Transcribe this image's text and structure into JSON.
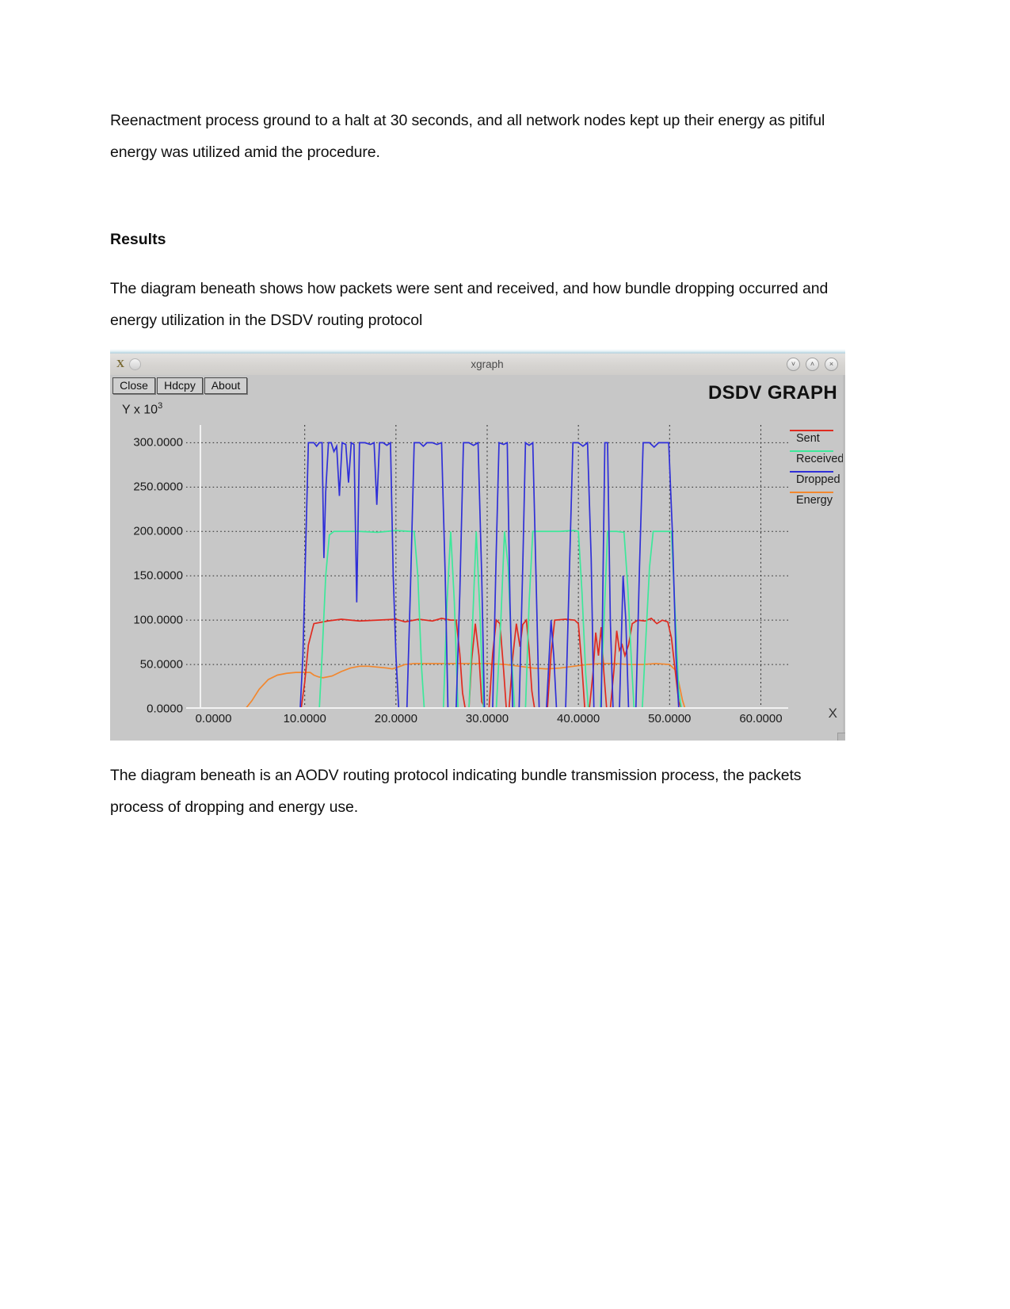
{
  "document": {
    "paragraph_1": "Reenactment process ground to a halt at 30 seconds, and all network nodes kept up their energy as pitiful energy was utilized amid the procedure.",
    "heading_results": "Results",
    "paragraph_2": "The diagram beneath shows how packets were sent and received, and how bundle dropping occurred and energy utilization in the DSDV routing protocol",
    "paragraph_3": "The diagram beneath is an AODV routing protocol indicating bundle transmission process, the packets process of dropping and energy use."
  },
  "xgraph_window": {
    "title": "xgraph",
    "app_icon": "X",
    "window_controls": {
      "minimize": "˅",
      "maximize": "˄",
      "close": "×"
    },
    "toolbar": {
      "close_label": "Close",
      "hdcpy_label": "Hdcpy",
      "about_label": "About"
    },
    "graph_title": "DSDV GRAPH",
    "y_axis_exponent_label": "Y x 10",
    "y_axis_exponent_value": "3",
    "corner_marker": "X"
  },
  "chart_data": {
    "type": "line",
    "title": "DSDV GRAPH",
    "xlabel": "",
    "ylabel": "Y x 10^3",
    "xlim": [
      -3,
      63
    ],
    "ylim": [
      0,
      320
    ],
    "grid": true,
    "legend_position": "right",
    "x_ticks": [
      "0.0000",
      "10.0000",
      "20.0000",
      "30.0000",
      "40.0000",
      "50.0000",
      "60.0000"
    ],
    "x_tick_values": [
      0,
      10,
      20,
      30,
      40,
      50,
      60
    ],
    "y_ticks": [
      "0.0000",
      "50.0000",
      "100.0000",
      "150.0000",
      "200.0000",
      "250.0000",
      "300.0000"
    ],
    "y_tick_values": [
      0,
      50,
      100,
      150,
      200,
      250,
      300
    ],
    "colors": {
      "sent": "#e02b20",
      "received": "#3ce89a",
      "dropped": "#2f2fd8",
      "energy": "#f2872e"
    },
    "series": [
      {
        "name": "Sent",
        "color": "#e02b20",
        "points": [
          [
            0,
            0
          ],
          [
            9.6,
            0
          ],
          [
            10.0,
            30
          ],
          [
            10.4,
            72
          ],
          [
            11.0,
            96
          ],
          [
            12.5,
            99
          ],
          [
            14,
            101
          ],
          [
            16,
            99
          ],
          [
            18,
            100
          ],
          [
            20,
            101
          ],
          [
            21,
            98
          ],
          [
            22.5,
            101
          ],
          [
            24,
            99
          ],
          [
            25,
            102
          ],
          [
            26,
            100
          ],
          [
            26.6,
            100
          ],
          [
            27.0,
            62
          ],
          [
            27.3,
            18
          ],
          [
            27.6,
            0
          ],
          [
            28.0,
            0
          ],
          [
            28.3,
            55
          ],
          [
            28.7,
            96
          ],
          [
            29.1,
            60
          ],
          [
            29.4,
            8
          ],
          [
            29.8,
            0
          ],
          [
            30.2,
            0
          ],
          [
            30.6,
            62
          ],
          [
            31.0,
            100
          ],
          [
            31.4,
            96
          ],
          [
            31.8,
            44
          ],
          [
            32.1,
            0
          ],
          [
            32.4,
            0
          ],
          [
            32.8,
            58
          ],
          [
            33.2,
            96
          ],
          [
            33.6,
            70
          ],
          [
            33.9,
            95
          ],
          [
            34.3,
            100
          ],
          [
            34.6,
            66
          ],
          [
            34.9,
            20
          ],
          [
            35.2,
            0
          ],
          [
            36.0,
            0
          ],
          [
            36.6,
            0
          ],
          [
            37.0,
            62
          ],
          [
            37.4,
            100
          ],
          [
            38.6,
            101
          ],
          [
            39.6,
            100
          ],
          [
            40.0,
            96
          ],
          [
            40.4,
            46
          ],
          [
            40.7,
            0
          ],
          [
            41.2,
            0
          ],
          [
            41.6,
            40
          ],
          [
            41.9,
            86
          ],
          [
            42.2,
            60
          ],
          [
            42.5,
            92
          ],
          [
            42.8,
            40
          ],
          [
            43.1,
            0
          ],
          [
            43.5,
            0
          ],
          [
            43.9,
            44
          ],
          [
            44.2,
            88
          ],
          [
            44.5,
            66
          ],
          [
            44.8,
            72
          ],
          [
            45.1,
            60
          ],
          [
            45.5,
            72
          ],
          [
            45.9,
            96
          ],
          [
            46.5,
            100
          ],
          [
            47.3,
            99
          ],
          [
            48.0,
            102
          ],
          [
            48.6,
            96
          ],
          [
            49.2,
            100
          ],
          [
            49.8,
            98
          ],
          [
            50.2,
            80
          ],
          [
            50.6,
            44
          ],
          [
            51.0,
            8
          ],
          [
            51.3,
            0
          ],
          [
            60,
            0
          ]
        ]
      },
      {
        "name": "Received",
        "color": "#3ce89a",
        "points": [
          [
            0,
            0
          ],
          [
            11.6,
            0
          ],
          [
            11.9,
            60
          ],
          [
            12.3,
            150
          ],
          [
            12.7,
            196
          ],
          [
            13.2,
            200
          ],
          [
            16,
            200
          ],
          [
            18,
            199
          ],
          [
            20,
            201
          ],
          [
            21.5,
            200
          ],
          [
            22.0,
            200
          ],
          [
            22.4,
            150
          ],
          [
            22.8,
            48
          ],
          [
            23.1,
            0
          ],
          [
            23.5,
            0
          ],
          [
            24.0,
            0
          ],
          [
            25.2,
            0
          ],
          [
            25.6,
            120
          ],
          [
            26.0,
            200
          ],
          [
            26.4,
            120
          ],
          [
            26.8,
            0
          ],
          [
            27.2,
            0
          ],
          [
            28.0,
            0
          ],
          [
            28.4,
            96
          ],
          [
            28.8,
            200
          ],
          [
            29.2,
            110
          ],
          [
            29.6,
            0
          ],
          [
            30.0,
            0
          ],
          [
            31.0,
            0
          ],
          [
            31.5,
            100
          ],
          [
            31.9,
            200
          ],
          [
            32.3,
            160
          ],
          [
            32.7,
            56
          ],
          [
            33.0,
            0
          ],
          [
            33.4,
            0
          ],
          [
            34.2,
            0
          ],
          [
            34.6,
            120
          ],
          [
            35.0,
            200
          ],
          [
            36.0,
            200
          ],
          [
            38.0,
            200
          ],
          [
            39.5,
            201
          ],
          [
            40.0,
            200
          ],
          [
            40.4,
            130
          ],
          [
            40.8,
            40
          ],
          [
            41.1,
            0
          ],
          [
            41.5,
            0
          ],
          [
            42.4,
            0
          ],
          [
            42.8,
            96
          ],
          [
            43.2,
            200
          ],
          [
            44.2,
            200
          ],
          [
            45.0,
            199
          ],
          [
            45.4,
            140
          ],
          [
            45.8,
            56
          ],
          [
            46.1,
            0
          ],
          [
            46.5,
            0
          ],
          [
            47.0,
            0
          ],
          [
            47.4,
            80
          ],
          [
            47.8,
            160
          ],
          [
            48.2,
            200
          ],
          [
            49.4,
            200
          ],
          [
            50.2,
            200
          ],
          [
            50.6,
            110
          ],
          [
            51.0,
            20
          ],
          [
            51.3,
            0
          ],
          [
            60,
            0
          ]
        ]
      },
      {
        "name": "Dropped",
        "color": "#2f2fd8",
        "points": [
          [
            0,
            0
          ],
          [
            9.5,
            0
          ],
          [
            9.8,
            60
          ],
          [
            10.1,
            180
          ],
          [
            10.4,
            300
          ],
          [
            11.0,
            300
          ],
          [
            11.3,
            296
          ],
          [
            11.6,
            300
          ],
          [
            11.9,
            300
          ],
          [
            12.1,
            170
          ],
          [
            12.3,
            245
          ],
          [
            12.6,
            300
          ],
          [
            12.9,
            300
          ],
          [
            13.2,
            290
          ],
          [
            13.5,
            296
          ],
          [
            13.8,
            240
          ],
          [
            14.1,
            300
          ],
          [
            14.5,
            298
          ],
          [
            14.8,
            255
          ],
          [
            15.1,
            300
          ],
          [
            15.4,
            298
          ],
          [
            15.7,
            120
          ],
          [
            16.0,
            300
          ],
          [
            16.6,
            300
          ],
          [
            17.2,
            298
          ],
          [
            17.6,
            300
          ],
          [
            17.9,
            230
          ],
          [
            18.2,
            300
          ],
          [
            18.6,
            300
          ],
          [
            19.0,
            297
          ],
          [
            19.4,
            300
          ],
          [
            19.7,
            150
          ],
          [
            20.0,
            60
          ],
          [
            20.3,
            0
          ],
          [
            20.7,
            0
          ],
          [
            21.2,
            0
          ],
          [
            21.6,
            140
          ],
          [
            22.0,
            300
          ],
          [
            22.6,
            300
          ],
          [
            23.0,
            296
          ],
          [
            23.4,
            300
          ],
          [
            24.0,
            300
          ],
          [
            24.5,
            298
          ],
          [
            25.0,
            300
          ],
          [
            25.4,
            150
          ],
          [
            25.7,
            0
          ],
          [
            26.1,
            0
          ],
          [
            26.6,
            0
          ],
          [
            27.0,
            130
          ],
          [
            27.4,
            300
          ],
          [
            28.0,
            300
          ],
          [
            28.5,
            297
          ],
          [
            29.0,
            300
          ],
          [
            29.4,
            150
          ],
          [
            29.7,
            0
          ],
          [
            30.1,
            0
          ],
          [
            30.6,
            0
          ],
          [
            31.0,
            180
          ],
          [
            31.3,
            300
          ],
          [
            31.8,
            298
          ],
          [
            32.2,
            300
          ],
          [
            32.5,
            120
          ],
          [
            32.8,
            0
          ],
          [
            33.1,
            0
          ],
          [
            33.5,
            0
          ],
          [
            33.9,
            160
          ],
          [
            34.2,
            300
          ],
          [
            34.6,
            297
          ],
          [
            35.0,
            300
          ],
          [
            35.4,
            130
          ],
          [
            35.7,
            0
          ],
          [
            36.0,
            0
          ],
          [
            36.5,
            0
          ],
          [
            37.0,
            100
          ],
          [
            37.3,
            60
          ],
          [
            37.6,
            0
          ],
          [
            38.0,
            0
          ],
          [
            38.6,
            0
          ],
          [
            39.0,
            150
          ],
          [
            39.4,
            300
          ],
          [
            40.0,
            300
          ],
          [
            40.5,
            296
          ],
          [
            41.0,
            300
          ],
          [
            41.4,
            170
          ],
          [
            41.7,
            0
          ],
          [
            42.1,
            0
          ],
          [
            42.5,
            0
          ],
          [
            42.9,
            300
          ],
          [
            43.2,
            300
          ],
          [
            43.5,
            100
          ],
          [
            43.8,
            0
          ],
          [
            44.1,
            0
          ],
          [
            44.5,
            0
          ],
          [
            44.9,
            150
          ],
          [
            45.2,
            100
          ],
          [
            45.5,
            0
          ],
          [
            45.9,
            0
          ],
          [
            46.3,
            0
          ],
          [
            46.7,
            160
          ],
          [
            47.1,
            300
          ],
          [
            47.8,
            300
          ],
          [
            48.3,
            295
          ],
          [
            48.8,
            300
          ],
          [
            49.4,
            300
          ],
          [
            49.9,
            300
          ],
          [
            50.3,
            200
          ],
          [
            50.7,
            60
          ],
          [
            51.0,
            0
          ],
          [
            60,
            0
          ]
        ]
      },
      {
        "name": "Energy",
        "color": "#f2872e",
        "points": [
          [
            0,
            0
          ],
          [
            3.5,
            0
          ],
          [
            4.2,
            9
          ],
          [
            5.0,
            22
          ],
          [
            6.0,
            33
          ],
          [
            7.0,
            38
          ],
          [
            8.0,
            40
          ],
          [
            9.0,
            41
          ],
          [
            10.0,
            41
          ],
          [
            10.6,
            41
          ],
          [
            11.0,
            38
          ],
          [
            11.5,
            36
          ],
          [
            12.0,
            35
          ],
          [
            13.0,
            37
          ],
          [
            14.0,
            42
          ],
          [
            15.0,
            46
          ],
          [
            16.0,
            48
          ],
          [
            17.0,
            48
          ],
          [
            18.0,
            47
          ],
          [
            19.0,
            46
          ],
          [
            19.6,
            45
          ],
          [
            20.2,
            47
          ],
          [
            21.0,
            50
          ],
          [
            22.0,
            51
          ],
          [
            23.0,
            51
          ],
          [
            24.5,
            51
          ],
          [
            26.0,
            51
          ],
          [
            28.0,
            51
          ],
          [
            30.0,
            51
          ],
          [
            32.0,
            50
          ],
          [
            33.5,
            48
          ],
          [
            35.0,
            46
          ],
          [
            36.5,
            45
          ],
          [
            38.0,
            46
          ],
          [
            39.5,
            48
          ],
          [
            41.0,
            50
          ],
          [
            42.5,
            51
          ],
          [
            44.0,
            51
          ],
          [
            45.5,
            50
          ],
          [
            47.0,
            50
          ],
          [
            48.5,
            51
          ],
          [
            50.0,
            50
          ],
          [
            50.6,
            44
          ],
          [
            51.0,
            30
          ],
          [
            51.4,
            10
          ],
          [
            51.7,
            0
          ],
          [
            60,
            0
          ]
        ]
      }
    ]
  },
  "legend": [
    {
      "label": "Sent",
      "color": "#e02b20"
    },
    {
      "label": "Received",
      "color": "#3ce89a"
    },
    {
      "label": "Dropped",
      "color": "#2f2fd8"
    },
    {
      "label": "Energy",
      "color": "#f2872e"
    }
  ]
}
